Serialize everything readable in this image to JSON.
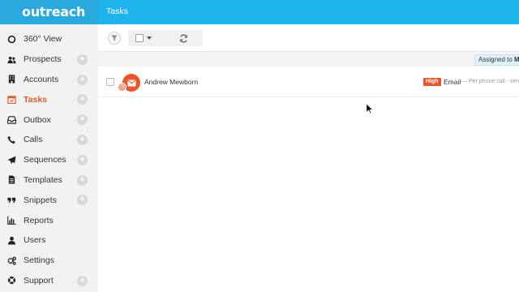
{
  "brand": {
    "logo_text": "outreach"
  },
  "header": {
    "title": "Tasks"
  },
  "sidebar": {
    "items": [
      {
        "label": "360° View",
        "icon": "circle-icon",
        "active": false,
        "has_add": false
      },
      {
        "label": "Prospects",
        "icon": "users-icon",
        "active": false,
        "has_add": true
      },
      {
        "label": "Accounts",
        "icon": "building-icon",
        "active": false,
        "has_add": true
      },
      {
        "label": "Tasks",
        "icon": "calendar-check-icon",
        "active": true,
        "has_add": true
      },
      {
        "label": "Outbox",
        "icon": "inbox-icon",
        "active": false,
        "has_add": true
      },
      {
        "label": "Calls",
        "icon": "phone-icon",
        "active": false,
        "has_add": true
      },
      {
        "label": "Sequences",
        "icon": "paper-plane-icon",
        "active": false,
        "has_add": true
      },
      {
        "label": "Templates",
        "icon": "document-icon",
        "active": false,
        "has_add": true
      },
      {
        "label": "Snippets",
        "icon": "quote-icon",
        "active": false,
        "has_add": true
      },
      {
        "label": "Reports",
        "icon": "bar-chart-icon",
        "active": false,
        "has_add": false
      },
      {
        "label": "Users",
        "icon": "user-icon",
        "active": false,
        "has_add": false
      },
      {
        "label": "Settings",
        "icon": "gears-icon",
        "active": false,
        "has_add": false
      },
      {
        "label": "Support",
        "icon": "lifebuoy-icon",
        "active": false,
        "has_add": true
      }
    ],
    "add_symbol": "+"
  },
  "toolbar": {
    "filter_icon": "filter-icon",
    "select_icon": "checkbox-dropdown-icon",
    "refresh_icon": "refresh-icon"
  },
  "filters": {
    "assigned_label": "Assigned to",
    "assigned_value": "Me"
  },
  "tasks": [
    {
      "name": "Andrew Mewborn",
      "avatar_icon": "envelope-icon",
      "badge_icon": "clock-icon",
      "priority": "High",
      "type": "Email",
      "description": "— Per phone call - send"
    }
  ],
  "colors": {
    "brand_blue": "#2aa9df",
    "header_blue": "#1eb3ea",
    "accent_orange": "#e8572b",
    "active_text": "#e05a2b",
    "sidebar_bg": "#f2f2f2"
  }
}
